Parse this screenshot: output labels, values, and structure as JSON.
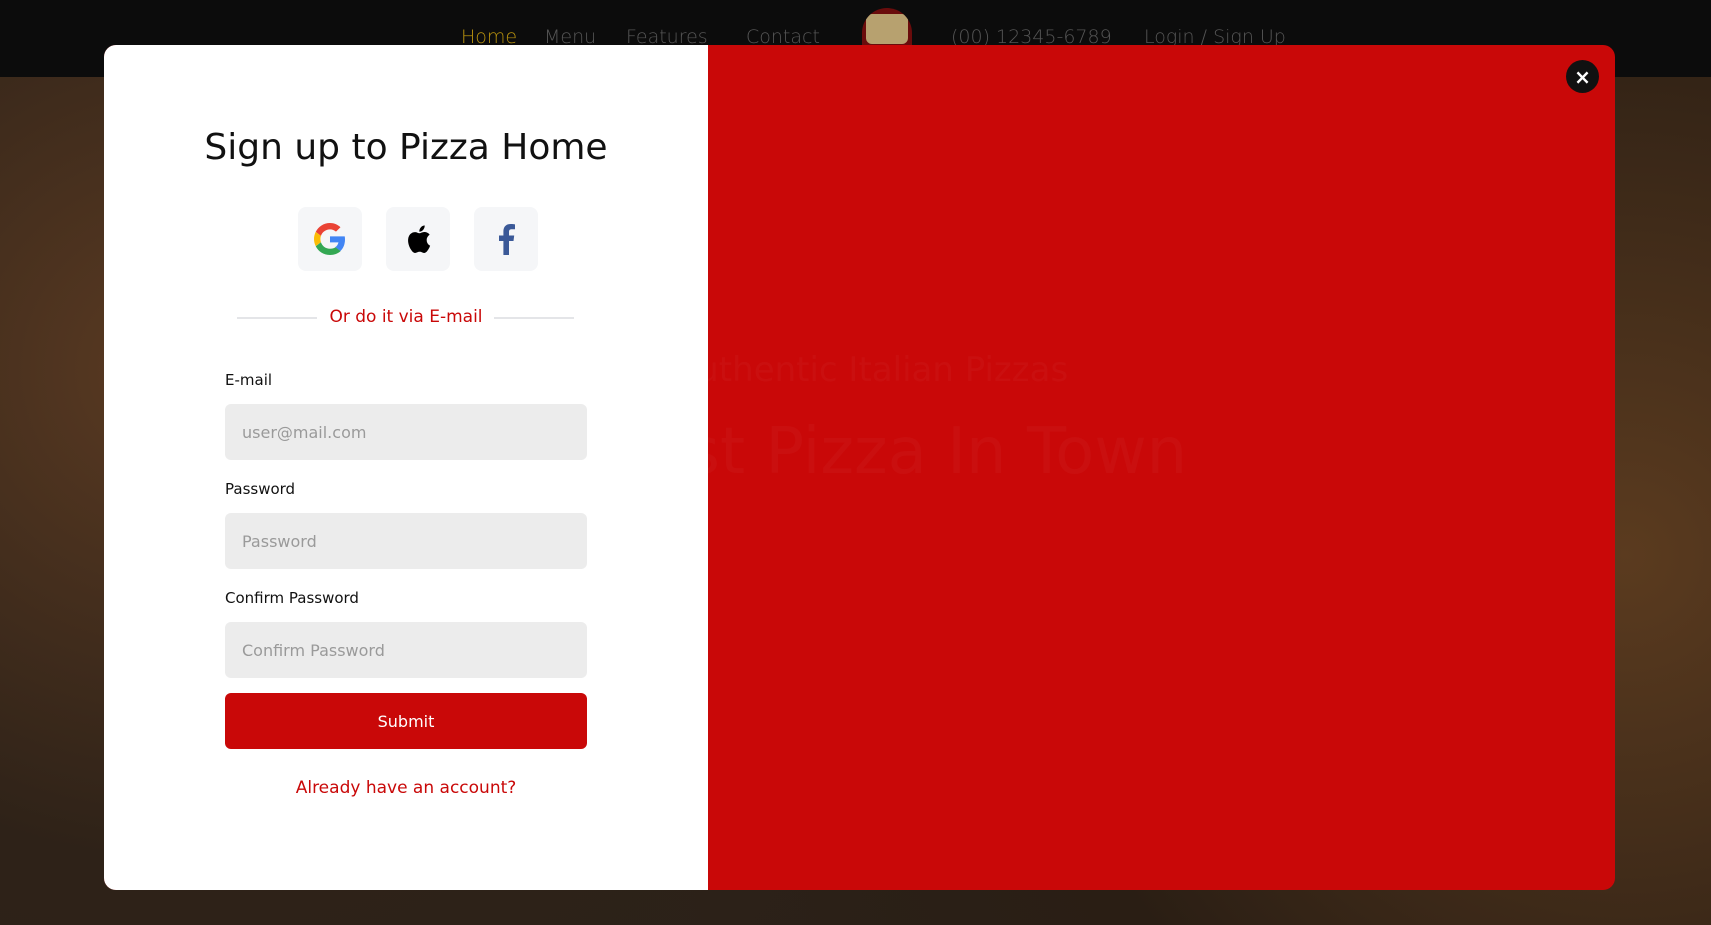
{
  "nav": {
    "home": "Home",
    "menu": "Menu",
    "features": "Features",
    "contact": "Contact",
    "phone": "(00) 12345-6789",
    "login": "Login / Sign Up"
  },
  "hero": {
    "subtitle": "Authentic Italian Pizzas",
    "title": "The Best Pizza In Town"
  },
  "modal": {
    "title": "Sign up to Pizza Home",
    "social": [
      "google-icon",
      "apple-icon",
      "facebook-icon"
    ],
    "divider": "Or do it via E-mail",
    "email_label": "E-mail",
    "email_placeholder": "user@mail.com",
    "email_value": "",
    "password_label": "Password",
    "password_placeholder": "Password",
    "password_value": "",
    "confirm_label": "Confirm Password",
    "confirm_placeholder": "Confirm Password",
    "confirm_value": "",
    "submit": "Submit",
    "login_link": "Already have an account?",
    "close": "×"
  },
  "colors": {
    "accent": "#c90808",
    "nav_active": "#b7910e",
    "header": "#0c0c0c"
  }
}
